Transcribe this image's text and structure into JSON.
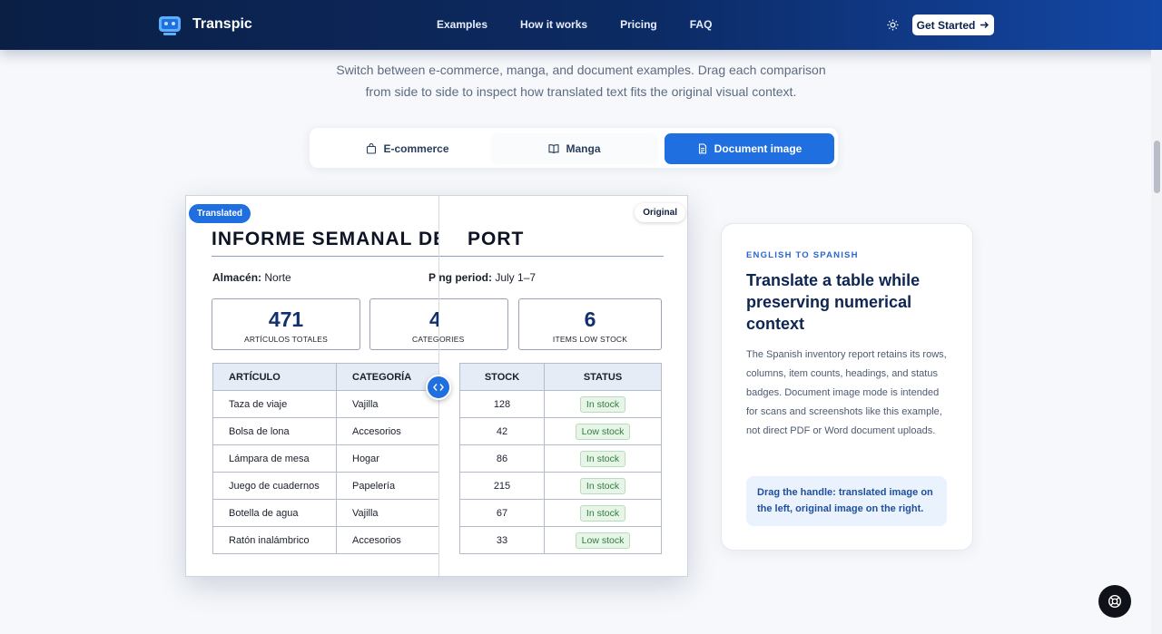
{
  "header": {
    "brand": "Transpic",
    "nav": [
      "Examples",
      "How it works",
      "Pricing",
      "FAQ"
    ],
    "cta_label": "Get Started"
  },
  "intro": {
    "line1": "Switch between e-commerce, manga, and document examples. Drag each comparison",
    "line2": "from side to side to inspect how translated text fits the original visual context."
  },
  "tabs": [
    {
      "label": "E-commerce",
      "icon": "bag-icon",
      "active": false
    },
    {
      "label": "Manga",
      "icon": "book-icon",
      "active": false
    },
    {
      "label": "Document image",
      "icon": "document-icon",
      "active": true
    }
  ],
  "comparison": {
    "translated_label": "Translated",
    "original_label": "Original",
    "translated": {
      "title": "INFORME SEMANAL DE",
      "meta_left_key": "Almacén:",
      "meta_left_val": "Norte",
      "meta_right_key": "P",
      "stats": [
        {
          "num": "471",
          "label": "ARTÍCULOS TOTALES"
        },
        {
          "num": "4",
          "label": "CATEG"
        }
      ],
      "columns": [
        "ARTÍCULO",
        "CATEGORÍA"
      ],
      "rows": [
        [
          "Taza de viaje",
          "Vajilla"
        ],
        [
          "Bolsa de lona",
          "Accesorios"
        ],
        [
          "Lámpara de mesa",
          "Hogar"
        ],
        [
          "Juego de cuadernos",
          "Papelería"
        ],
        [
          "Botella de agua",
          "Vajilla"
        ],
        [
          "Ratón inalámbrico",
          "Accesorios"
        ]
      ]
    },
    "original": {
      "title": "PORT",
      "meta_key": "ing period:",
      "meta_val": "July 1–7",
      "stats": [
        {
          "num": "",
          "label": "ORIES"
        },
        {
          "num": "6",
          "label": "ITEMS LOW STOCK"
        }
      ],
      "columns": [
        "STOCK",
        "STATUS"
      ],
      "rows": [
        [
          "128",
          "In stock"
        ],
        [
          "42",
          "Low stock"
        ],
        [
          "86",
          "In stock"
        ],
        [
          "215",
          "In stock"
        ],
        [
          "67",
          "In stock"
        ],
        [
          "33",
          "Low stock"
        ]
      ]
    }
  },
  "info": {
    "eyebrow": "ENGLISH TO SPANISH",
    "heading": "Translate a table while preserving numerical context",
    "body": "The Spanish inventory report retains its rows, columns, item counts, headings, and status badges. Document image mode is intended for scans and screenshots like this example, not direct PDF or Word document uploads.",
    "note": "Drag the handle: translated image on the left, original image on the right."
  },
  "colors": {
    "accent": "#1f6fe0",
    "header_dark": "#0b1f45"
  }
}
